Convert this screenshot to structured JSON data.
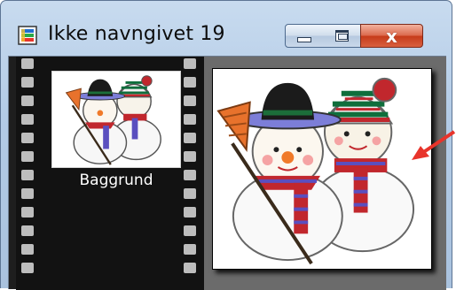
{
  "window": {
    "title": "Ikke navngivet 19",
    "icon": "image-document-icon",
    "controls": {
      "minimize_icon": "minimize-icon",
      "maximize_icon": "maximize-icon",
      "close_symbol": "x"
    }
  },
  "layers": [
    {
      "name": "Baggrund",
      "thumbnail": "snowmen-illustration"
    }
  ],
  "canvas": {
    "image": "snowmen-illustration"
  },
  "annotation": {
    "icon": "red-arrow-icon",
    "color": "#e8342b"
  },
  "colors": {
    "titlebar": "#b3cbe6",
    "panel_background": "#121212",
    "close_button": "#c63b1a"
  }
}
